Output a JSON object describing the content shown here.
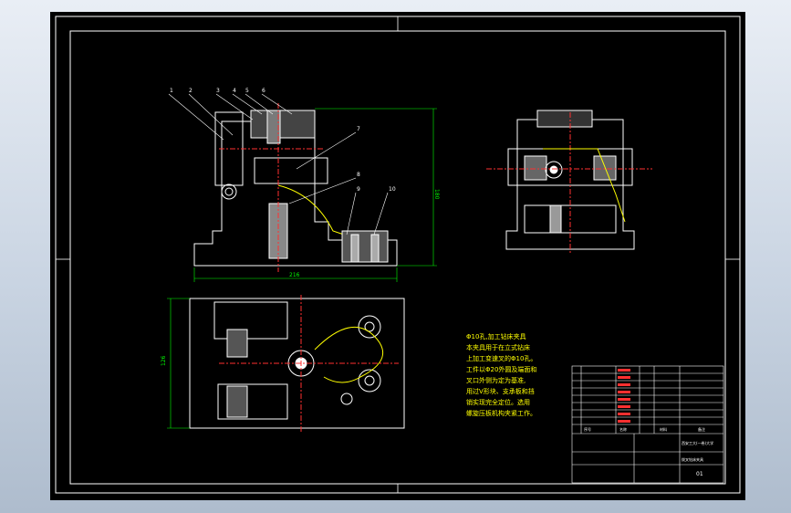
{
  "drawing": {
    "part_labels": [
      "1",
      "2",
      "3",
      "4",
      "5",
      "6",
      "7",
      "8",
      "9",
      "10"
    ],
    "dimension_width": "216",
    "dimension_height": "180",
    "dimension_plan": "126",
    "description_lines": [
      "Φ10孔,加工钻床夹具",
      "本夹具用于在立式钻床",
      "上加工变速叉的Φ10孔。",
      "工件以Φ20外圆及端面和",
      "叉口外侧为定为基准,",
      "用过V形块、支承板和挡",
      "销实现完全定位。选用",
      "螺旋压板机构夹紧工作。"
    ],
    "title_block": {
      "header": [
        "序号",
        "名称",
        "材料",
        "备注"
      ],
      "school": "西安工大(一卷)大学",
      "drawing_name": "拨叉钻床夹具",
      "drawing_number": "01"
    }
  },
  "colors": {
    "background": "#000000",
    "frame": "#ffffff",
    "annotation": "#ffff00",
    "centerline": "#ff3030",
    "dimension": "#00ff00"
  }
}
